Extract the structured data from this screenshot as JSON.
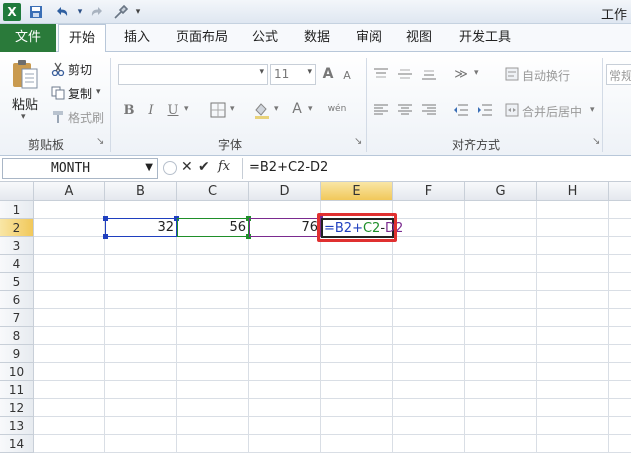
{
  "quick_access": {
    "app_icon": "X",
    "save_icon": "save-icon",
    "undo_icon": "undo-icon",
    "redo_icon": "redo-icon",
    "tools_icon": "tools-icon",
    "title": "工作"
  },
  "tabs": [
    {
      "label": "文件"
    },
    {
      "label": "开始"
    },
    {
      "label": "插入"
    },
    {
      "label": "页面布局"
    },
    {
      "label": "公式"
    },
    {
      "label": "数据"
    },
    {
      "label": "审阅"
    },
    {
      "label": "视图"
    },
    {
      "label": "开发工具"
    }
  ],
  "ribbon": {
    "clipboard": {
      "paste_label": "粘贴",
      "cut_label": "剪切",
      "copy_label": "复制",
      "format_painter_label": "格式刷",
      "group_label": "剪贴板"
    },
    "font": {
      "font_size": "11",
      "bold": "B",
      "italic": "I",
      "underline": "U",
      "grow": "A",
      "shrink": "A",
      "color_a": "A",
      "wen": "wén",
      "group_label": "字体"
    },
    "alignment": {
      "wrap_label": "自动换行",
      "merge_label": "合并后居中",
      "group_label": "对齐方式"
    },
    "number": {
      "format_label": "常规"
    }
  },
  "formula_bar": {
    "name_box": "MONTH",
    "fx_label": "fx",
    "cancel_symbol": "✕",
    "enter_symbol": "✔",
    "formula": "=B2+C2-D2"
  },
  "columns": [
    "A",
    "B",
    "C",
    "D",
    "E",
    "F",
    "G",
    "H"
  ],
  "rows": [
    "1",
    "2",
    "3",
    "4",
    "5",
    "6",
    "7",
    "8",
    "9",
    "10",
    "11",
    "12",
    "13",
    "14"
  ],
  "cells": {
    "B2": "32",
    "C2": "56",
    "D2": "76",
    "E2_parts": [
      "=B2+",
      "C2",
      "-",
      "D2"
    ]
  },
  "colors": {
    "b_ref": "#1f3fbf",
    "c_ref": "#1f8f2a",
    "d_ref": "#7a2a8f",
    "highlight": "#e03030",
    "file_tab": "#2a7a3a"
  }
}
